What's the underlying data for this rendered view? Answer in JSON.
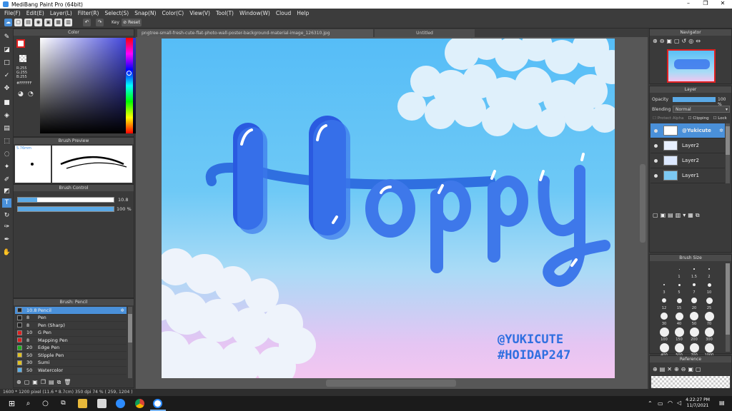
{
  "window": {
    "title": "MediBang Paint Pro (64bit)"
  },
  "menu": [
    "File(F)",
    "Edit(E)",
    "Layer(L)",
    "Filter(R)",
    "Select(S)",
    "Snap(N)",
    "Color(C)",
    "View(V)",
    "Tool(T)",
    "Window(W)",
    "Cloud",
    "Help"
  ],
  "toolbar": {
    "key_label": "Key",
    "reset_label": "Reset"
  },
  "color_panel": {
    "title": "Color",
    "r": "R:255",
    "g": "G:255",
    "b": "B:255",
    "hex": "#FFFFFF"
  },
  "brush_preview": {
    "title": "Brush Preview",
    "size": "5.76mm"
  },
  "brush_control": {
    "title": "Brush Control",
    "size_value": "10.8",
    "opacity_value": "100 %"
  },
  "brush_list": {
    "title": "Brush: Pencil",
    "items": [
      {
        "size": "10.8",
        "name": "Pencil",
        "color": "#222222",
        "selected": true
      },
      {
        "size": "8",
        "name": "Pen",
        "color": "#222222"
      },
      {
        "size": "8",
        "name": "Pen (Sharp)",
        "color": "#222222"
      },
      {
        "size": "10",
        "name": "G Pen",
        "color": "#e02020"
      },
      {
        "size": "8",
        "name": "Mapping Pen",
        "color": "#e02020"
      },
      {
        "size": "20",
        "name": "Edge Pen",
        "color": "#20b020"
      },
      {
        "size": "50",
        "name": "Stipple Pen",
        "color": "#e0c020"
      },
      {
        "size": "30",
        "name": "Sumi",
        "color": "#e0c020"
      },
      {
        "size": "50",
        "name": "Watercolor",
        "color": "#5ab0e8"
      }
    ]
  },
  "tabs": [
    {
      "label": "pngtree-small-fresh-cute-flat-photo-wall-poster-background-material-image_126310.jpg"
    },
    {
      "label": "Untitled"
    }
  ],
  "artwork": {
    "main_text": "Happy",
    "credit1": "@YUKICUTE",
    "credit2": "#HOIDAP247"
  },
  "navigator": {
    "title": "Navigator"
  },
  "layers": {
    "title": "Layer",
    "opacity_label": "Opacity",
    "opacity_value": "100 %",
    "opacity_level": 1.0,
    "blending_label": "Blending",
    "blending_value": "Normal",
    "protect_alpha": "Protect Alpha",
    "clipping": "Clipping",
    "lock": "Lock",
    "items": [
      {
        "name": "@Yukicute",
        "selected": true
      },
      {
        "name": "Layer2"
      },
      {
        "name": "Layer2"
      },
      {
        "name": "Layer1"
      }
    ]
  },
  "brush_size": {
    "title": "Brush Size",
    "sizes": [
      "1",
      "1.5",
      "2",
      "3",
      "5",
      "7",
      "10",
      "12",
      "15",
      "20",
      "25",
      "30",
      "40",
      "50",
      "70",
      "100",
      "150",
      "200",
      "300",
      "400",
      "500",
      "700",
      "1000"
    ]
  },
  "reference": {
    "title": "Reference"
  },
  "status": {
    "text": "1600 * 1200 pixel  (11.6 * 8.7cm)  350 dpi  74 %  ( 259, 1204 )"
  },
  "taskbar": {
    "time": "4:22:27 PM",
    "date": "11/7/2021"
  },
  "colors": {
    "accent": "#4a90d9",
    "selection": "#2f7fd0"
  }
}
